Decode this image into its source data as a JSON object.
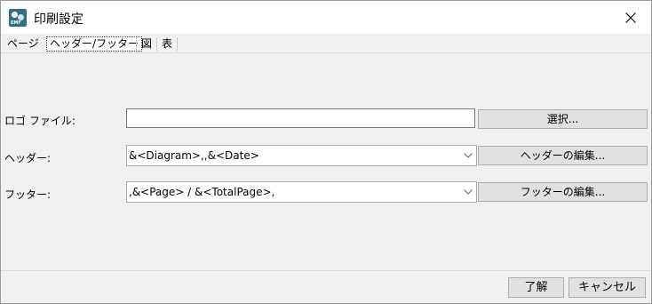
{
  "window": {
    "title": "印刷設定",
    "app_icon": "app-logo-icon",
    "close_icon": "close-icon"
  },
  "tabs": [
    {
      "label": "ページ"
    },
    {
      "label": "ヘッダー/フッター",
      "selected": true
    },
    {
      "label": "図"
    },
    {
      "label": "表"
    }
  ],
  "form": {
    "logo_label": "ロゴ ファイル:",
    "logo_value": "",
    "select_button": "選択...",
    "header_label": "ヘッダー:",
    "header_value": "&<Diagram>,,&<Date>",
    "edit_header_button": "ヘッダーの編集...",
    "footer_label": "フッター:",
    "footer_value": ",&<Page> / &<TotalPage>,",
    "edit_footer_button": "フッターの編集...",
    "dropdown_icon": "chevron-down-icon"
  },
  "buttons": {
    "ok": "了解",
    "cancel": "キャンセル"
  }
}
